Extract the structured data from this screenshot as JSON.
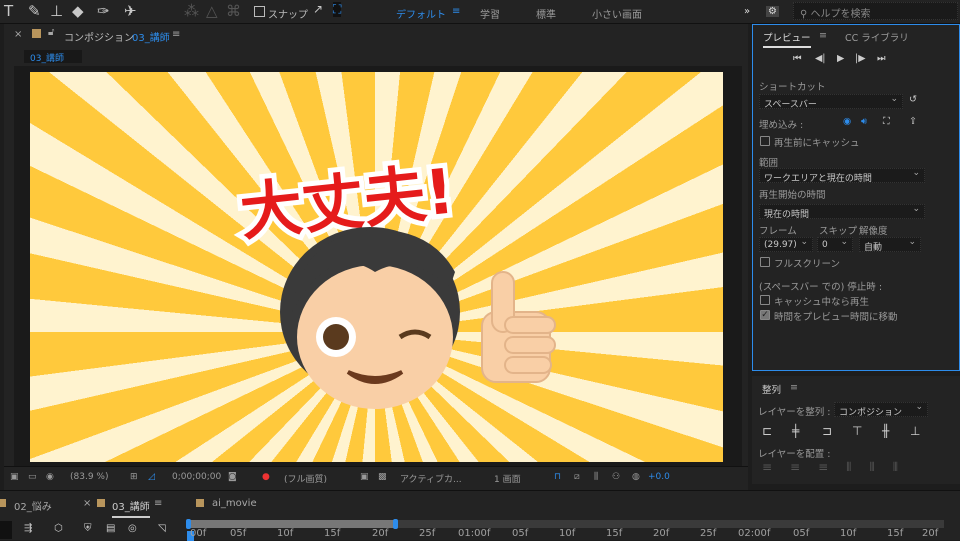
{
  "toolbar": {
    "snap_label": "スナップ",
    "workspaces": [
      "デフォルト",
      "学習",
      "標準",
      "小さい画面"
    ],
    "active_workspace": "デフォルト",
    "search_placeholder": "ヘルプを検索",
    "more": "»"
  },
  "composition_panel": {
    "title_prefix": "コンポジション",
    "comp_name": "03_講師",
    "breadcrumb": "03_講師"
  },
  "canvas": {
    "headline": "大丈夫!"
  },
  "viewer_bar": {
    "zoom": "(83.9 %)",
    "timecode": "0;00;00;00",
    "quality": "(フル画質)",
    "camera": "アクティブカ...",
    "views": "1 画面",
    "exposure": "+0.0"
  },
  "preview_panel": {
    "tabs": [
      "プレビュー",
      "CC ライブラリ"
    ],
    "shortcut_label": "ショートカット",
    "shortcut_value": "スペースバー",
    "embed_label": "埋め込み :",
    "cache_before": "再生前にキャッシュ",
    "range_label": "範囲",
    "range_value": "ワークエリアと現在の時間",
    "start_label": "再生開始の時間",
    "start_value": "現在の時間",
    "frame_label": "フレーム",
    "skip_label": "スキップ",
    "res_label": "解像度",
    "frame_value": "(29.97)",
    "skip_value": "0",
    "res_value": "自動",
    "fullscreen": "フルスクリーン",
    "on_stop_label": "(スペースバー での) 停止時 :",
    "cache_play": "キャッシュ中なら再生",
    "move_time": "時間をプレビュー時間に移動",
    "move_time_checked": true
  },
  "align_panel": {
    "title": "整列",
    "align_to_label": "レイヤーを整列 :",
    "align_to_value": "コンポジション",
    "distribute_label": "レイヤーを配置 :"
  },
  "timeline": {
    "tabs": [
      "02_悩み",
      "03_講師",
      "ai_movie"
    ],
    "active_tab": "03_講師",
    "ruler": [
      "00f",
      "05f",
      "10f",
      "15f",
      "20f",
      "25f",
      "01:00f",
      "05f",
      "10f",
      "15f",
      "20f",
      "25f",
      "02:00f",
      "05f",
      "10f",
      "15f",
      "20f"
    ]
  },
  "colors": {
    "accent": "#2d8ceb",
    "background_yellow": "#ffc93c",
    "headline_red": "#e51b1b"
  }
}
